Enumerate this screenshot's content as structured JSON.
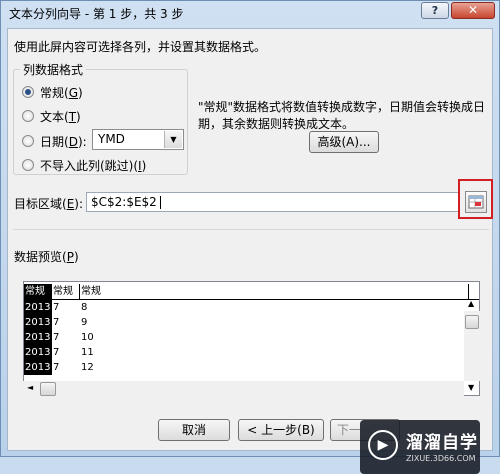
{
  "window": {
    "title": "文本分列向导 - 第 1 步，共 3 步",
    "help_label": "?",
    "close_label": "✕"
  },
  "instructions": "使用此屏内容可选择各列，并设置其数据格式。",
  "column_format": {
    "group_title": "列数据格式",
    "options": [
      {
        "label": "常规(",
        "key": "G",
        "suffix": ")",
        "checked": true
      },
      {
        "label": "文本(",
        "key": "T",
        "suffix": ")",
        "checked": false
      },
      {
        "label": "日期(",
        "key": "D",
        "suffix": "):",
        "checked": false
      },
      {
        "label": "不导入此列(跳过)(",
        "key": "I",
        "suffix": ")",
        "checked": false
      }
    ],
    "date_format_value": "YMD",
    "description_line1": "\"常规\"数据格式将数值转换成数字，日期值会转换成日",
    "description_line2": "期，其余数据则转换成文本。",
    "advanced_button_label": "高级(A)..."
  },
  "destination": {
    "label": "目标区域(",
    "label_key": "E",
    "label_suffix": "):",
    "value": "$C$2:$E$2"
  },
  "preview": {
    "label": "数据预览(",
    "label_key": "P",
    "label_suffix": ")",
    "headers": [
      "常规",
      "常规",
      "常规"
    ],
    "rows": [
      [
        "2013",
        "7",
        "8"
      ],
      [
        "2013",
        "7",
        "9"
      ],
      [
        "2013",
        "7",
        "10"
      ],
      [
        "2013",
        "7",
        "11"
      ],
      [
        "2013",
        "7",
        "12"
      ]
    ]
  },
  "buttons": {
    "cancel": "取消",
    "back": "< 上一步(B)",
    "next": "下一"
  },
  "watermark": {
    "name": "溜溜自学",
    "url": "ZIXUE.3D66.COM"
  },
  "colors": {
    "highlight_box": "#d21f24",
    "selected_column": "#000000"
  }
}
